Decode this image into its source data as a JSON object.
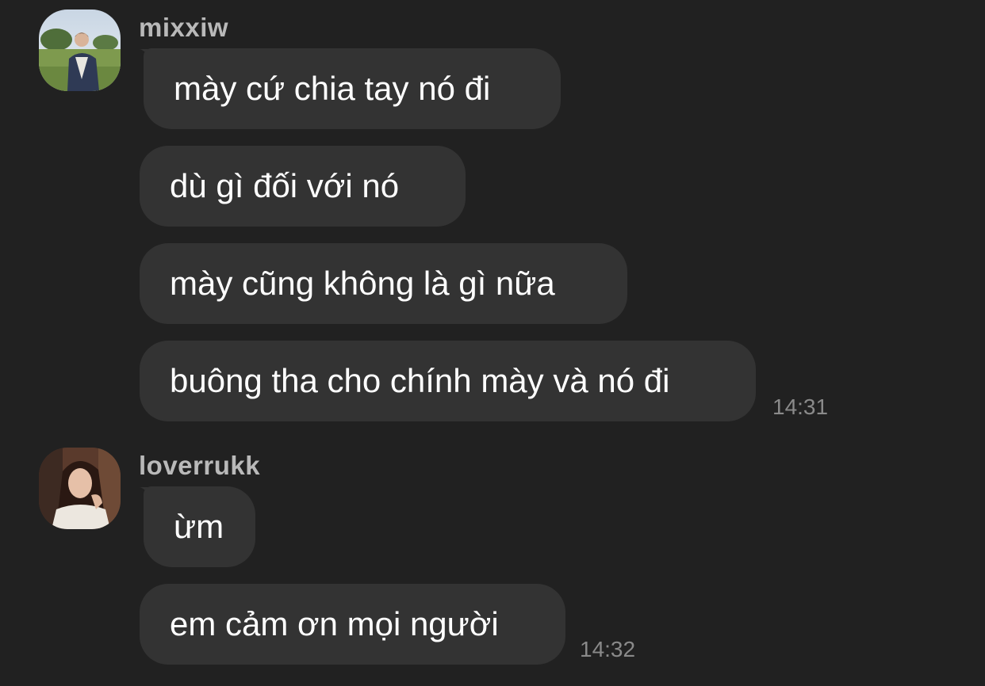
{
  "groups": [
    {
      "sender": "mixxiw",
      "avatar_icon": "user-avatar-photo-man",
      "messages": [
        "mày cứ chia tay nó đi",
        "dù gì đối với nó",
        "mày cũng không là gì nữa",
        "buông tha cho chính mày và nó đi"
      ],
      "time": "14:31"
    },
    {
      "sender": "loverrukk",
      "avatar_icon": "user-avatar-photo-woman",
      "messages": [
        "ừm",
        "em cảm ơn mọi người"
      ],
      "time": "14:32"
    }
  ],
  "colors": {
    "background": "#212121",
    "bubble": "#333333",
    "sender": "#b9b9b9",
    "message_text": "#ffffff",
    "timestamp": "#8a8a8a"
  }
}
